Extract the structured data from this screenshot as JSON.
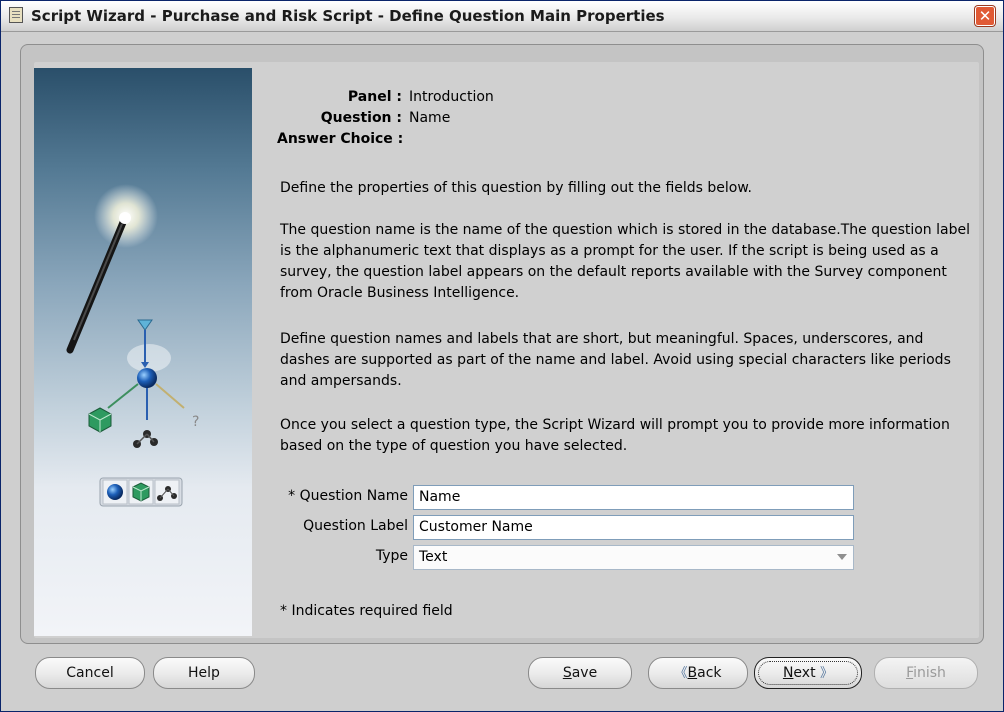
{
  "window": {
    "title": "Script Wizard - Purchase and Risk Script - Define Question Main Properties",
    "close_symbol": "✕"
  },
  "summary": {
    "panel_label": "Panel :",
    "panel_value": "Introduction",
    "question_label": "Question :",
    "question_value": "Name",
    "answer_choice_label": "Answer Choice :",
    "answer_choice_value": ""
  },
  "instructions": [
    "Define the properties of this question by filling out the fields below.",
    "The question name is the name of the question which is stored in the database.The question label is the alphanumeric text that displays as a prompt for the user. If the script is being used as a survey, the question label appears on the default reports available with the Survey component from Oracle Business Intelligence.",
    "Define question names and labels that are short, but meaningful. Spaces, underscores, and dashes are supported as part of the name and label. Avoid using special characters like periods and ampersands.",
    "Once you select a question type, the Script Wizard will prompt you to provide more information based on the type of question you have selected."
  ],
  "form": {
    "question_name_label": "* Question Name",
    "question_name_value": "Name",
    "question_label_label": "Question Label",
    "question_label_value": "Customer Name",
    "type_label": "Type",
    "type_value": "Text"
  },
  "required_note": "* Indicates required field",
  "buttons": {
    "cancel": "Cancel",
    "help": "Help",
    "save_first": "S",
    "save_rest": "ave",
    "back_first": "B",
    "back_rest": "ack",
    "next_first": "N",
    "next_rest": "ext",
    "finish_first": "F",
    "finish_rest": "inish",
    "back_chevron": "《",
    "next_chevron": "》"
  },
  "icons": {
    "wand": "magic-wand-icon",
    "tree": "question-branch-icon",
    "sphere": "sphere-icon",
    "cube": "cube-icon",
    "nodes": "nodes-icon"
  },
  "colors": {
    "accent": "#7f9db9",
    "close": "#e05a35"
  }
}
